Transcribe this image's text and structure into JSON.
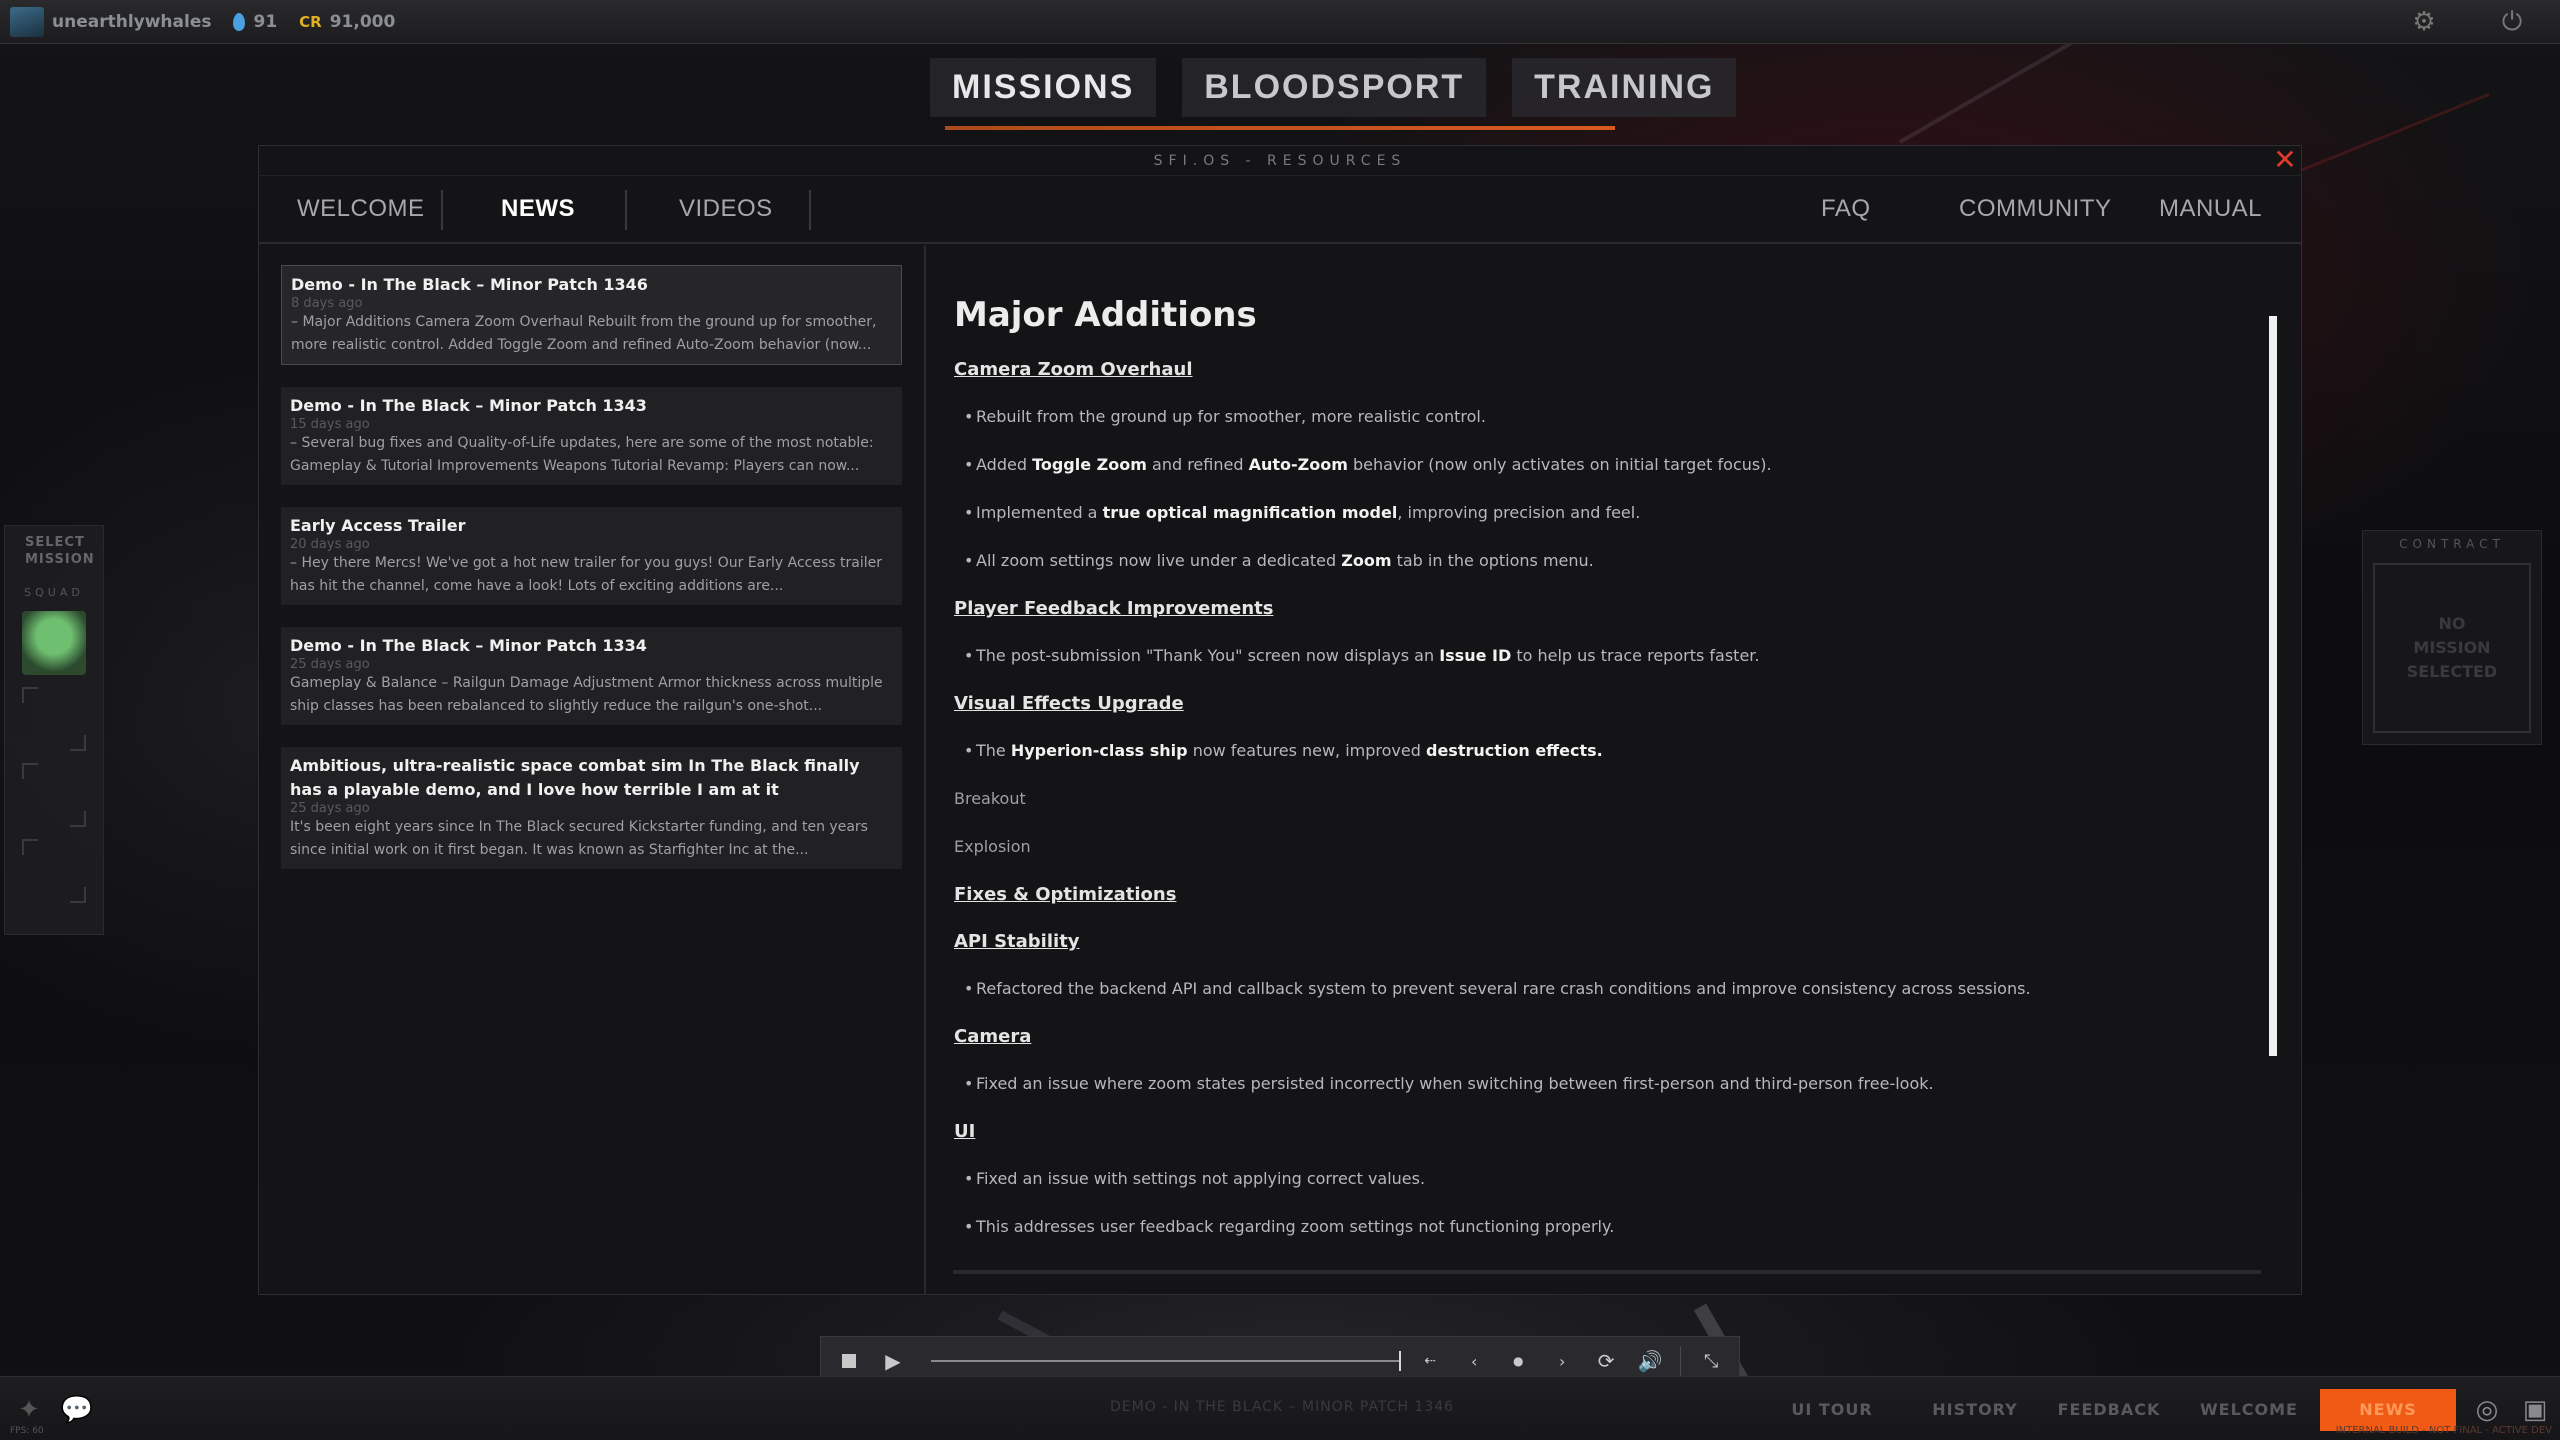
{
  "topbar": {
    "username": "unearthlywhales",
    "drops": "91",
    "credits_label": "CR",
    "credits": "91,000"
  },
  "mode_tabs": [
    "MISSIONS",
    "BLOODSPORT",
    "TRAINING"
  ],
  "left_sidebar": {
    "label": "SELECT MISSION",
    "squad_label": "SQUAD"
  },
  "contract": {
    "title": "CONTRACT",
    "empty": "NO MISSION SELECTED"
  },
  "modal": {
    "title": "SFI.OS - RESOURCES",
    "close_glyph": "✕",
    "tabs_left": [
      "WELCOME",
      "NEWS",
      "VIDEOS"
    ],
    "tabs_right": [
      "FAQ",
      "COMMUNITY",
      "MANUAL"
    ],
    "active_tab": "NEWS"
  },
  "news": [
    {
      "title": "Demo - In The Black – Minor Patch 1346",
      "date": "8 days ago",
      "snippet": "– Major Additions Camera Zoom Overhaul Rebuilt from the ground up for smoother, more realistic control. Added Toggle Zoom and refined Auto-Zoom behavior (now..."
    },
    {
      "title": "Demo - In The Black – Minor Patch 1343",
      "date": "15 days ago",
      "snippet": "– Several bug fixes and Quality-of-Life updates, here are some of the most notable: Gameplay & Tutorial Improvements Weapons Tutorial Revamp: Players can now..."
    },
    {
      "title": "Early Access Trailer",
      "date": "20 days ago",
      "snippet": "– Hey there Mercs! We've got a hot new trailer for you guys! Our Early Access trailer has hit the channel, come have a look! Lots of exciting additions are..."
    },
    {
      "title": "Demo - In The Black – Minor Patch 1334",
      "date": "25 days ago",
      "snippet": "Gameplay & Balance – Railgun Damage Adjustment Armor thickness across multiple ship classes has been rebalanced to slightly reduce the railgun's one-shot..."
    },
    {
      "title": "Ambitious, ultra-realistic space combat sim In The Black finally has a playable demo, and I love how terrible I am at it",
      "date": "25 days ago",
      "snippet": "It's been eight years since In The Black secured Kickstarter funding, and ten years since initial work on it first began. It was known as Starfighter Inc at the..."
    }
  ],
  "article": {
    "heading": "Major Additions",
    "sections": {
      "s1": "Camera Zoom Overhaul",
      "s2": "Player Feedback Improvements",
      "s3": "Visual Effects Upgrade",
      "s4": "Fixes & Optimizations",
      "s5": "API Stability",
      "s6": "Camera",
      "s7": "UI"
    },
    "b1": "Rebuilt from the ground up for smoother, more realistic control.",
    "b2": {
      "pre": "Added ",
      "b1": "Toggle Zoom",
      "mid": " and refined ",
      "b2": "Auto-Zoom",
      "post": " behavior (now only activates on initial target focus)."
    },
    "b3": {
      "pre": "Implemented a ",
      "b": "true optical magnification model",
      "post": ", improving precision and feel."
    },
    "b4": {
      "pre": "All zoom settings now live under a dedicated ",
      "b": "Zoom",
      "post": " tab in the options menu."
    },
    "b5": {
      "pre": "The post-submission \"Thank You\" screen now displays an ",
      "b": "Issue ID",
      "post": " to help us trace reports faster."
    },
    "b6": {
      "pre": "The ",
      "b1": "Hyperion-class ship",
      "mid": " now features new, improved ",
      "b2": "destruction effects."
    },
    "p1": "Breakout",
    "p2": "Explosion",
    "b7": "Refactored the backend API and callback system to prevent several rare crash conditions and improve consistency across sessions.",
    "b8": "Fixed an issue where zoom states persisted incorrectly when switching between first-person and third-person free-look.",
    "b9": "Fixed an issue with settings not applying correct values.",
    "b10": "This addresses user feedback regarding zoom settings not functioning properly."
  },
  "video_controls": {
    "progress": 1.0
  },
  "bottombar": {
    "caption": "DEMO - IN THE BLACK – MINOR PATCH 1346",
    "buttons": [
      "UI TOUR",
      "HISTORY",
      "FEEDBACK",
      "WELCOME",
      "NEWS"
    ],
    "active": "NEWS",
    "fps": "FPS: 60",
    "version": "INTERNAL BUILD - NOT FINAL - ACTIVE DEV"
  },
  "colors": {
    "accent": "#f05a14",
    "close": "#e03a2a",
    "credits": "#e0b020"
  }
}
